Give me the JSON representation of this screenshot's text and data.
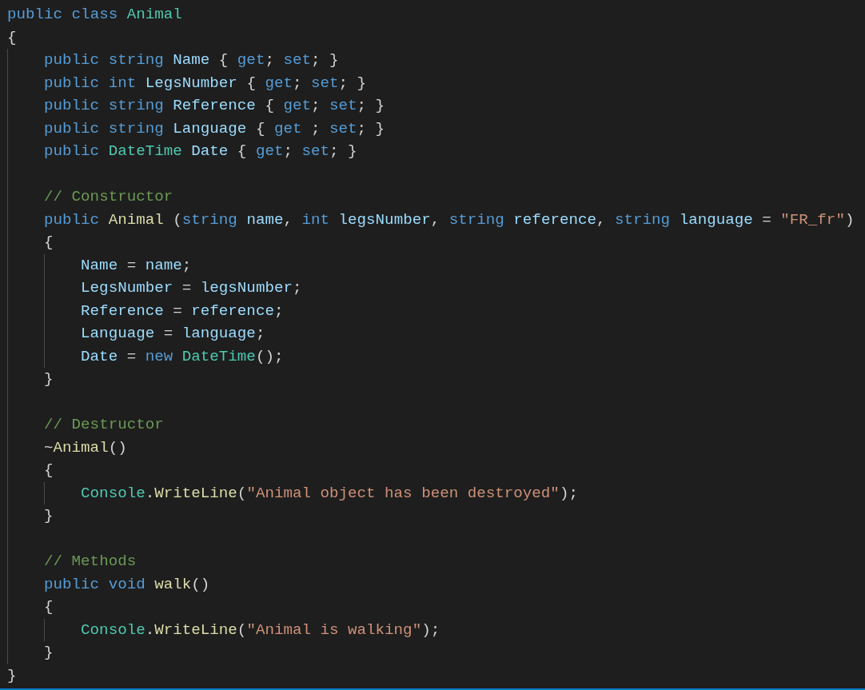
{
  "editor": {
    "lines": [
      {
        "kind": "code",
        "tokens": [
          {
            "text": "public class ",
            "kind": "kw"
          },
          {
            "text": "Animal",
            "kind": "type"
          }
        ]
      },
      {
        "kind": "code",
        "tokens": [
          {
            "text": "{",
            "kind": "punc"
          }
        ]
      },
      {
        "kind": "block",
        "children": [
          {
            "kind": "code",
            "tokens": [
              {
                "text": "public string ",
                "kind": "kw"
              },
              {
                "text": "Name",
                "kind": "prop"
              },
              {
                "text": " { ",
                "kind": "punc"
              },
              {
                "text": "get",
                "kind": "kw"
              },
              {
                "text": "; ",
                "kind": "punc"
              },
              {
                "text": "set",
                "kind": "kw"
              },
              {
                "text": "; }",
                "kind": "punc"
              }
            ]
          },
          {
            "kind": "code",
            "tokens": [
              {
                "text": "public int ",
                "kind": "kw"
              },
              {
                "text": "LegsNumber",
                "kind": "prop"
              },
              {
                "text": " { ",
                "kind": "punc"
              },
              {
                "text": "get",
                "kind": "kw"
              },
              {
                "text": "; ",
                "kind": "punc"
              },
              {
                "text": "set",
                "kind": "kw"
              },
              {
                "text": "; }",
                "kind": "punc"
              }
            ]
          },
          {
            "kind": "code",
            "tokens": [
              {
                "text": "public string ",
                "kind": "kw"
              },
              {
                "text": "Reference",
                "kind": "prop"
              },
              {
                "text": " { ",
                "kind": "punc"
              },
              {
                "text": "get",
                "kind": "kw"
              },
              {
                "text": "; ",
                "kind": "punc"
              },
              {
                "text": "set",
                "kind": "kw"
              },
              {
                "text": "; }",
                "kind": "punc"
              }
            ]
          },
          {
            "kind": "code",
            "tokens": [
              {
                "text": "public string ",
                "kind": "kw"
              },
              {
                "text": "Language",
                "kind": "prop"
              },
              {
                "text": " { ",
                "kind": "punc"
              },
              {
                "text": "get",
                "kind": "kw"
              },
              {
                "text": " ; ",
                "kind": "punc"
              },
              {
                "text": "set",
                "kind": "kw"
              },
              {
                "text": "; }",
                "kind": "punc"
              }
            ]
          },
          {
            "kind": "code",
            "tokens": [
              {
                "text": "public ",
                "kind": "kw"
              },
              {
                "text": "DateTime ",
                "kind": "type"
              },
              {
                "text": "Date",
                "kind": "prop"
              },
              {
                "text": " { ",
                "kind": "punc"
              },
              {
                "text": "get",
                "kind": "kw"
              },
              {
                "text": "; ",
                "kind": "punc"
              },
              {
                "text": "set",
                "kind": "kw"
              },
              {
                "text": "; }",
                "kind": "punc"
              }
            ]
          },
          {
            "kind": "blank"
          },
          {
            "kind": "code",
            "tokens": [
              {
                "text": "// Constructor",
                "kind": "comment"
              }
            ]
          },
          {
            "kind": "code",
            "tokens": [
              {
                "text": "public ",
                "kind": "kw"
              },
              {
                "text": "Animal",
                "kind": "method"
              },
              {
                "text": " (",
                "kind": "punc"
              },
              {
                "text": "string ",
                "kind": "kw"
              },
              {
                "text": "name",
                "kind": "prop"
              },
              {
                "text": ", ",
                "kind": "punc"
              },
              {
                "text": "int ",
                "kind": "kw"
              },
              {
                "text": "legsNumber",
                "kind": "prop"
              },
              {
                "text": ", ",
                "kind": "punc"
              },
              {
                "text": "string ",
                "kind": "kw"
              },
              {
                "text": "reference",
                "kind": "prop"
              },
              {
                "text": ", ",
                "kind": "punc"
              },
              {
                "text": "string ",
                "kind": "kw"
              },
              {
                "text": "language",
                "kind": "prop"
              },
              {
                "text": " = ",
                "kind": "punc"
              },
              {
                "text": "\"FR_fr\"",
                "kind": "str"
              },
              {
                "text": ")",
                "kind": "punc"
              }
            ]
          },
          {
            "kind": "code",
            "tokens": [
              {
                "text": "{",
                "kind": "punc"
              }
            ]
          },
          {
            "kind": "block",
            "children": [
              {
                "kind": "code",
                "tokens": [
                  {
                    "text": "Name",
                    "kind": "prop"
                  },
                  {
                    "text": " = ",
                    "kind": "punc"
                  },
                  {
                    "text": "name",
                    "kind": "prop"
                  },
                  {
                    "text": ";",
                    "kind": "punc"
                  }
                ]
              },
              {
                "kind": "code",
                "tokens": [
                  {
                    "text": "LegsNumber",
                    "kind": "prop"
                  },
                  {
                    "text": " = ",
                    "kind": "punc"
                  },
                  {
                    "text": "legsNumber",
                    "kind": "prop"
                  },
                  {
                    "text": ";",
                    "kind": "punc"
                  }
                ]
              },
              {
                "kind": "code",
                "tokens": [
                  {
                    "text": "Reference",
                    "kind": "prop"
                  },
                  {
                    "text": " = ",
                    "kind": "punc"
                  },
                  {
                    "text": "reference",
                    "kind": "prop"
                  },
                  {
                    "text": ";",
                    "kind": "punc"
                  }
                ]
              },
              {
                "kind": "code",
                "tokens": [
                  {
                    "text": "Language",
                    "kind": "prop"
                  },
                  {
                    "text": " = ",
                    "kind": "punc"
                  },
                  {
                    "text": "language",
                    "kind": "prop"
                  },
                  {
                    "text": ";",
                    "kind": "punc"
                  }
                ]
              },
              {
                "kind": "code",
                "tokens": [
                  {
                    "text": "Date",
                    "kind": "prop"
                  },
                  {
                    "text": " = ",
                    "kind": "punc"
                  },
                  {
                    "text": "new ",
                    "kind": "kw"
                  },
                  {
                    "text": "DateTime",
                    "kind": "type"
                  },
                  {
                    "text": "();",
                    "kind": "punc"
                  }
                ]
              }
            ]
          },
          {
            "kind": "code",
            "tokens": [
              {
                "text": "}",
                "kind": "punc"
              }
            ]
          },
          {
            "kind": "blank"
          },
          {
            "kind": "code",
            "tokens": [
              {
                "text": "// Destructor",
                "kind": "comment"
              }
            ]
          },
          {
            "kind": "code",
            "tokens": [
              {
                "text": "~",
                "kind": "punc"
              },
              {
                "text": "Animal",
                "kind": "method"
              },
              {
                "text": "()",
                "kind": "punc"
              }
            ]
          },
          {
            "kind": "code",
            "tokens": [
              {
                "text": "{",
                "kind": "punc"
              }
            ]
          },
          {
            "kind": "block",
            "children": [
              {
                "kind": "code",
                "tokens": [
                  {
                    "text": "Console",
                    "kind": "type"
                  },
                  {
                    "text": ".",
                    "kind": "punc"
                  },
                  {
                    "text": "WriteLine",
                    "kind": "method"
                  },
                  {
                    "text": "(",
                    "kind": "punc"
                  },
                  {
                    "text": "\"Animal object has been destroyed\"",
                    "kind": "str"
                  },
                  {
                    "text": ");",
                    "kind": "punc"
                  }
                ]
              }
            ]
          },
          {
            "kind": "code",
            "tokens": [
              {
                "text": "}",
                "kind": "punc"
              }
            ]
          },
          {
            "kind": "blank"
          },
          {
            "kind": "code",
            "tokens": [
              {
                "text": "// Methods",
                "kind": "comment"
              }
            ]
          },
          {
            "kind": "code",
            "tokens": [
              {
                "text": "public void ",
                "kind": "kw"
              },
              {
                "text": "walk",
                "kind": "method"
              },
              {
                "text": "()",
                "kind": "punc"
              }
            ]
          },
          {
            "kind": "code",
            "tokens": [
              {
                "text": "{",
                "kind": "punc"
              }
            ]
          },
          {
            "kind": "block",
            "children": [
              {
                "kind": "code",
                "tokens": [
                  {
                    "text": "Console",
                    "kind": "type"
                  },
                  {
                    "text": ".",
                    "kind": "punc"
                  },
                  {
                    "text": "WriteLine",
                    "kind": "method"
                  },
                  {
                    "text": "(",
                    "kind": "punc"
                  },
                  {
                    "text": "\"Animal is walking\"",
                    "kind": "str"
                  },
                  {
                    "text": ");",
                    "kind": "punc"
                  }
                ]
              }
            ]
          },
          {
            "kind": "code",
            "tokens": [
              {
                "text": "}",
                "kind": "punc"
              }
            ]
          }
        ]
      },
      {
        "kind": "code",
        "tokens": [
          {
            "text": "}",
            "kind": "punc"
          }
        ]
      }
    ]
  }
}
